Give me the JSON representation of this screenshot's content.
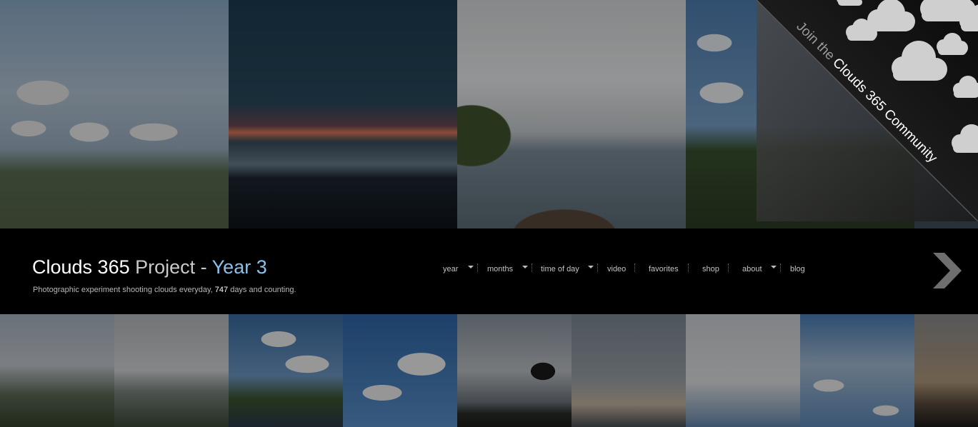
{
  "header": {
    "title_main": "Clouds 365",
    "title_project": " Project - ",
    "title_year": "Year 3",
    "tagline_prefix": "Photographic experiment shooting clouds everyday, ",
    "tagline_days": "747",
    "tagline_suffix": " days and counting."
  },
  "nav": {
    "items": [
      {
        "label": "year",
        "dropdown": true
      },
      {
        "label": "months",
        "dropdown": true
      },
      {
        "label": "time of day",
        "dropdown": true
      },
      {
        "label": "video",
        "dropdown": false
      },
      {
        "label": "favorites",
        "dropdown": false
      },
      {
        "label": "shop",
        "dropdown": false
      },
      {
        "label": "about",
        "dropdown": true
      },
      {
        "label": "blog",
        "dropdown": false
      }
    ]
  },
  "corner_banner": {
    "prefix": "Join the ",
    "highlight": "Clouds 365 Community",
    "icon": "cloud-icon"
  },
  "next_button": {
    "icon": "chevron-right-icon"
  },
  "colors": {
    "background": "#000000",
    "title_white": "#ffffff",
    "title_project": "#c9c9c9",
    "title_year": "#8cc0ea",
    "nav_text": "#c2c2c2"
  }
}
